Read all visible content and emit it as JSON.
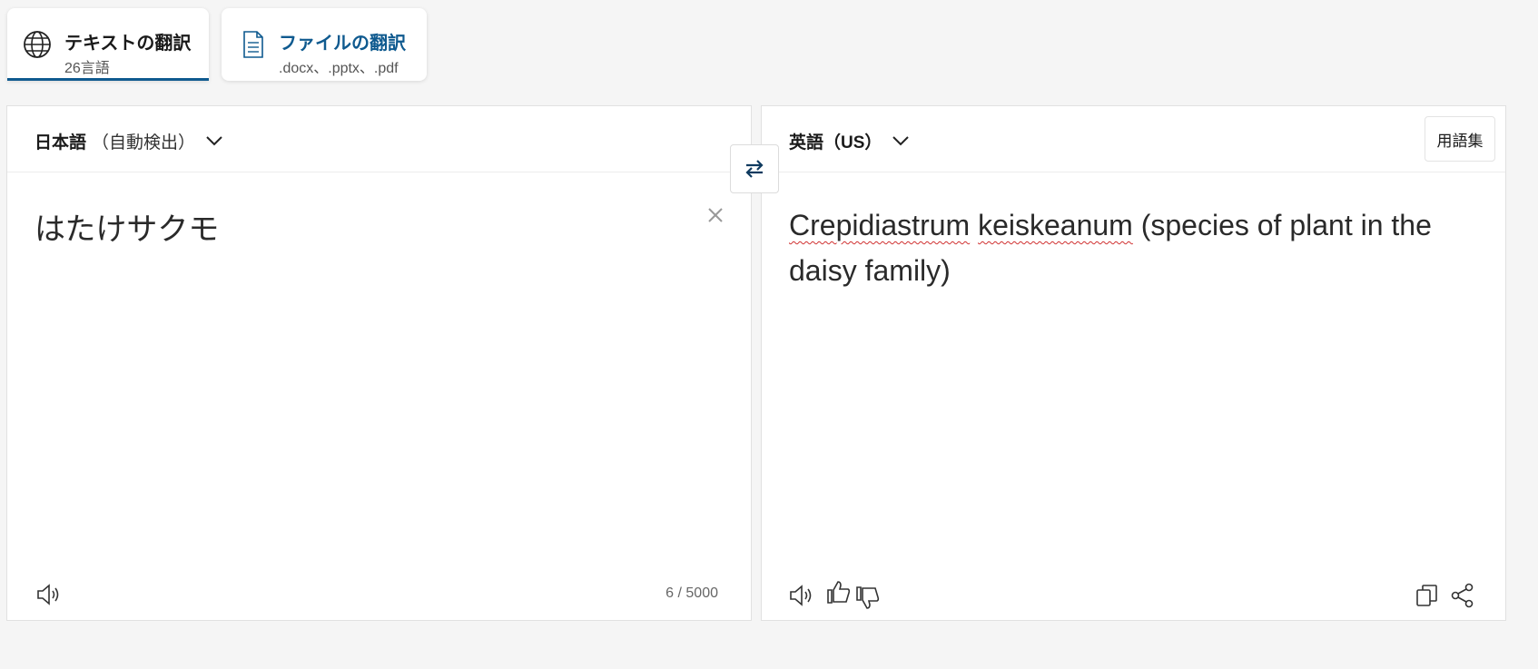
{
  "tabs": {
    "text": {
      "title": "テキストの翻訳",
      "subtitle": "26言語"
    },
    "file": {
      "title": "ファイルの翻訳",
      "subtitle": ".docx、.pptx、.pdf"
    }
  },
  "source": {
    "language": "日本語",
    "detect_label": "（自動検出）",
    "text": "はたけサクモ",
    "char_count": "6 / 5000"
  },
  "target": {
    "language": "英語（US）",
    "glossary_label": "用語集",
    "misspelled_1": "Crepidiastrum",
    "misspelled_2": "keiskeanum",
    "text_rest": " (species of plant in the daisy family)"
  },
  "colors": {
    "accent": "#0f5a8f",
    "background": "#f5f5f5",
    "panel": "#ffffff"
  },
  "icons": [
    "globe-icon",
    "document-icon",
    "chevron-down-icon",
    "swap-icon",
    "close-icon",
    "speaker-icon",
    "thumbs-up-icon",
    "thumbs-down-icon",
    "copy-icon",
    "share-icon"
  ]
}
